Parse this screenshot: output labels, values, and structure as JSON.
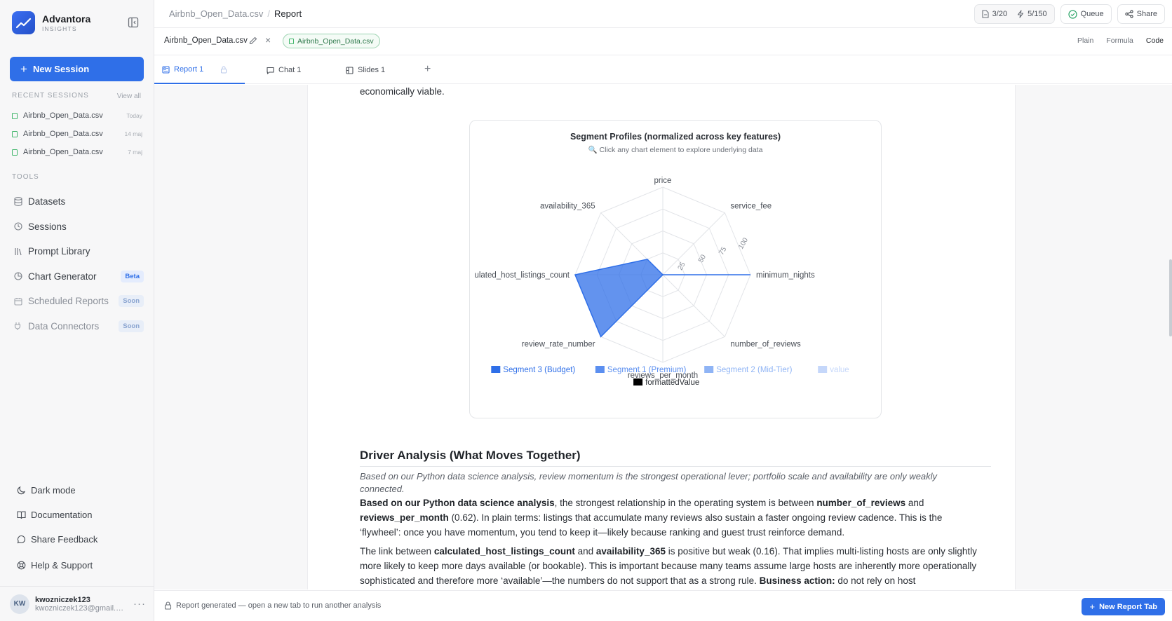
{
  "brand": {
    "name": "Advantora",
    "sub": "INSIGHTS"
  },
  "sidebar": {
    "new_session": "New Session",
    "recent_label": "RECENT SESSIONS",
    "view_all": "View all",
    "recent": [
      {
        "name": "Airbnb_Open_Data.csv",
        "date": "Today"
      },
      {
        "name": "Airbnb_Open_Data.csv",
        "date": "14 maj"
      },
      {
        "name": "Airbnb_Open_Data.csv",
        "date": "7 maj"
      }
    ],
    "tools_label": "TOOLS",
    "tools": [
      {
        "label": "Datasets",
        "icon": "database-icon",
        "badge": ""
      },
      {
        "label": "Sessions",
        "icon": "clock-icon",
        "badge": ""
      },
      {
        "label": "Prompt Library",
        "icon": "library-icon",
        "badge": ""
      },
      {
        "label": "Chart Generator",
        "icon": "pie-chart-icon",
        "badge": "Beta"
      },
      {
        "label": "Scheduled Reports",
        "icon": "calendar-icon",
        "badge": "Soon"
      },
      {
        "label": "Data Connectors",
        "icon": "plug-icon",
        "badge": "Soon"
      }
    ],
    "bottom": [
      {
        "label": "Dark mode",
        "icon": "moon-icon"
      },
      {
        "label": "Documentation",
        "icon": "book-icon"
      },
      {
        "label": "Share Feedback",
        "icon": "message-icon"
      },
      {
        "label": "Help & Support",
        "icon": "lifebuoy-icon"
      }
    ],
    "user": {
      "initials": "KW",
      "name": "kwozniczek123",
      "email": "kwozniczek123@gmail.com"
    }
  },
  "topbar": {
    "crumb_file": "Airbnb_Open_Data.csv",
    "crumb_sep": "/",
    "crumb_page": "Report",
    "reports_count": "3/20",
    "credits_count": "5/150",
    "queue": "Queue",
    "share": "Share"
  },
  "filebar": {
    "name": "Airbnb_Open_Data.csv",
    "chip": "Airbnb_Open_Data.csv",
    "modes": [
      "Plain",
      "Formula",
      "Code"
    ],
    "active_mode": "Code"
  },
  "tabs": [
    {
      "label": "Report 1",
      "icon": "report-icon"
    },
    {
      "label": "Chat 1",
      "icon": "chat-icon"
    },
    {
      "label": "Slides 1",
      "icon": "slides-icon"
    }
  ],
  "tab_add": "+",
  "doc": {
    "top_text": "economically viable.",
    "heading": "Driver Analysis (What Moves Together)",
    "italic": "Based on our Python data science analysis, review momentum is the strongest operational lever; portfolio scale and availability are only weakly connected.",
    "p1": {
      "a": "Based on our Python data science analysis",
      "b": ", the strongest relationship in the operating system is between ",
      "c": "number_of_reviews",
      "d": " and ",
      "e": "reviews_per_month",
      "f": " (0.62). In plain terms: listings that accumulate many reviews also sustain a faster ongoing review cadence. This is the ‘flywheel’: once you have momentum, you tend to keep it—likely because ranking and guest trust reinforce demand."
    },
    "p2": {
      "a": "The link between ",
      "b": "calculated_host_listings_count",
      "c": " and ",
      "d": "availability_365",
      "e": " is positive but weak (0.16). That implies multi-listing hosts are only slightly more likely to keep more days available (or bookable). This is important because many teams assume large hosts are inherently more operationally sophisticated and therefore more ‘available’—the numbers do not support that as a strong rule. ",
      "f": "Business action:",
      "g": " do not rely on host"
    }
  },
  "footer": {
    "message": "Report generated — open a new tab to run another analysis",
    "new_report": "New Report Tab"
  },
  "chart_data": {
    "type": "radar",
    "title": "Segment Profiles (normalized across key features)",
    "subtitle": "🔍 Click any chart element to explore underlying data",
    "axes": [
      "price",
      "service_fee",
      "minimum_nights",
      "number_of_reviews",
      "reviews_per_month",
      "review_rate_number",
      "ulated_host_listings_count",
      "availability_365"
    ],
    "radial_ticks": [
      25,
      50,
      75,
      100
    ],
    "range": [
      0,
      100
    ],
    "series": [
      {
        "name": "Segment 3 (Budget)",
        "color": "#2f6fe8",
        "values": [
          0,
          0,
          100,
          0,
          0,
          100,
          100,
          25
        ]
      },
      {
        "name": "Segment 1 (Premium)",
        "color": "#5b8ff0",
        "values": [
          0,
          0,
          0,
          0,
          0,
          0,
          0,
          0
        ]
      },
      {
        "name": "Segment 2 (Mid-Tier)",
        "color": "#8fb4f5",
        "values": [
          0,
          0,
          0,
          0,
          0,
          0,
          0,
          0
        ]
      },
      {
        "name": "value",
        "color": "#c5d7fa",
        "values": []
      },
      {
        "name": "formattedValue",
        "color": "#000000",
        "values": []
      }
    ]
  }
}
